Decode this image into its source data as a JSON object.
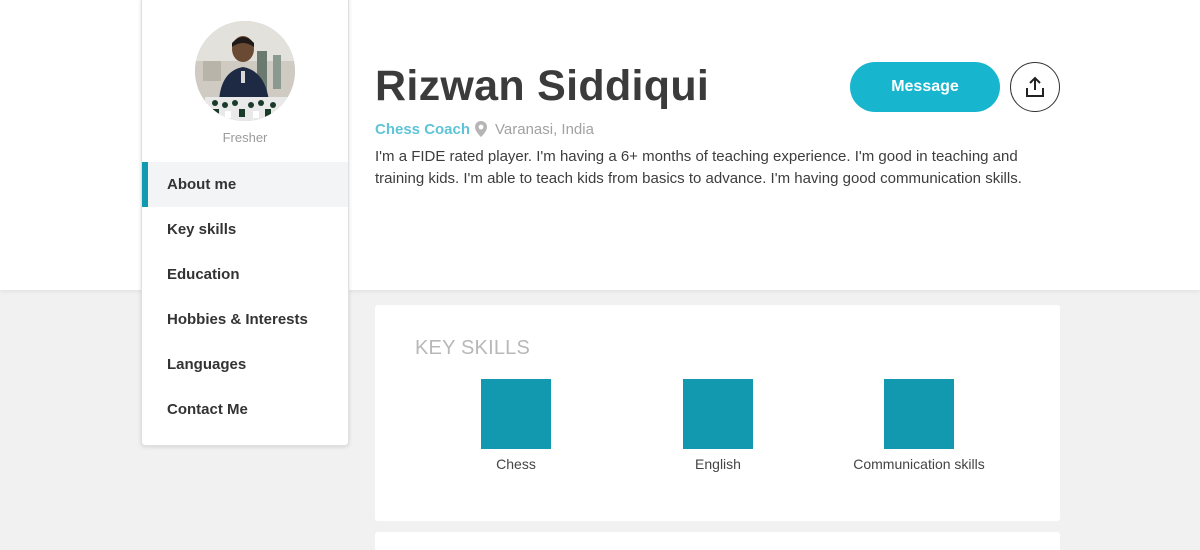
{
  "profile": {
    "name": "Rizwan Siddiqui",
    "status": "Fresher",
    "role": "Chess Coach",
    "location": "Varanasi, India",
    "bio": "I'm a FIDE rated player. I'm having a 6+ months of teaching experience. I'm good in teaching and training kids. I'm able to teach kids from basics to advance. I'm having good communication skills."
  },
  "actions": {
    "message_label": "Message",
    "share_icon": "share-upload-icon"
  },
  "nav": {
    "items": [
      {
        "label": "About me",
        "active": true
      },
      {
        "label": "Key skills"
      },
      {
        "label": "Education"
      },
      {
        "label": "Hobbies & Interests"
      },
      {
        "label": "Languages"
      },
      {
        "label": "Contact Me"
      }
    ]
  },
  "key_skills": {
    "title": "KEY SKILLS",
    "items": [
      {
        "label": "Chess"
      },
      {
        "label": "English"
      },
      {
        "label": "Communication skills"
      }
    ]
  },
  "colors": {
    "accent": "#18b5cf",
    "skill_tile": "#1299b0",
    "role_text": "#5ec4d6"
  }
}
